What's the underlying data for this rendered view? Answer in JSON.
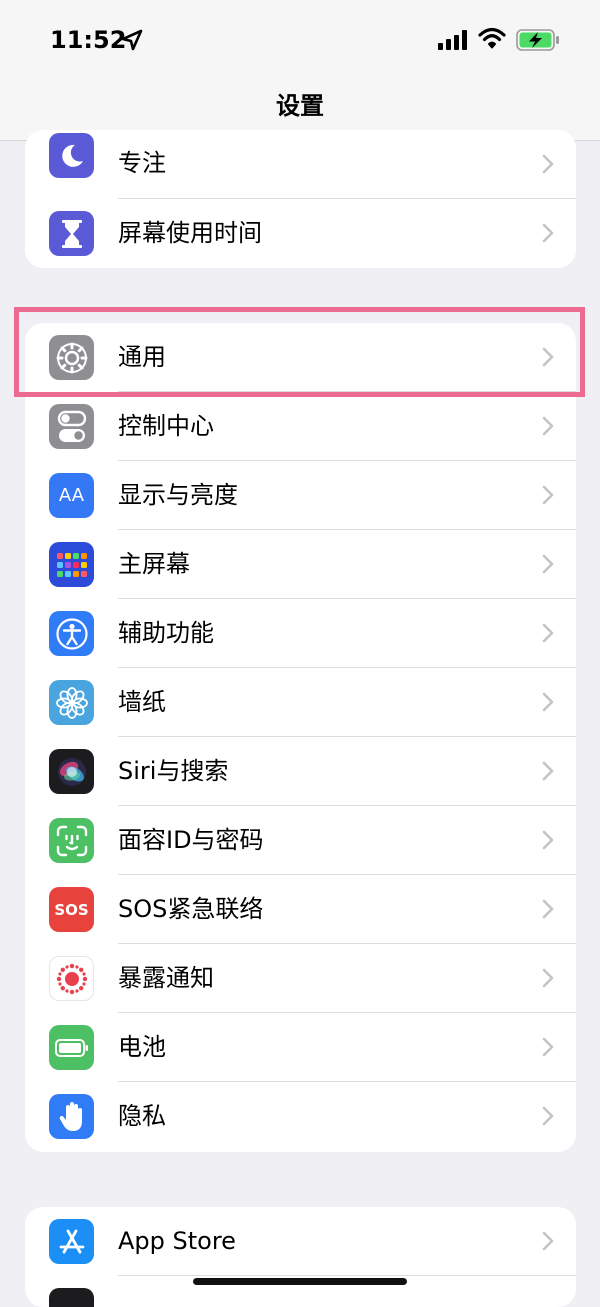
{
  "status_bar": {
    "time": "11:52"
  },
  "nav": {
    "title": "设置"
  },
  "groups": [
    {
      "items": [
        {
          "label": "专注",
          "icon": "moon-icon",
          "color": "#5b5ad6"
        },
        {
          "label": "屏幕使用时间",
          "icon": "hourglass-icon",
          "color": "#5b5ad6"
        }
      ]
    },
    {
      "items": [
        {
          "label": "通用",
          "icon": "gear-icon",
          "color": "#8e8e93"
        },
        {
          "label": "控制中心",
          "icon": "toggles-icon",
          "color": "#8e8e93"
        },
        {
          "label": "显示与亮度",
          "icon": "text-size-icon",
          "icon_text": "AA",
          "color": "#3478f6"
        },
        {
          "label": "主屏幕",
          "icon": "home-screen-grid-icon",
          "color": "#2b4bd8"
        },
        {
          "label": "辅助功能",
          "icon": "accessibility-icon",
          "color": "#2f7cf6"
        },
        {
          "label": "墙纸",
          "icon": "flower-icon",
          "color": "#4aa4de"
        },
        {
          "label": "Siri与搜索",
          "icon": "siri-icon",
          "color": "#1c1c1e"
        },
        {
          "label": "面容ID与密码",
          "icon": "face-id-icon",
          "color": "#4cc062"
        },
        {
          "label": "SOS紧急联络",
          "icon": "sos-icon",
          "icon_text": "SOS",
          "color": "#e7423c"
        },
        {
          "label": "暴露通知",
          "icon": "exposure-dots-icon",
          "color": "#ffffff"
        },
        {
          "label": "电池",
          "icon": "battery-icon",
          "color": "#4cc062"
        },
        {
          "label": "隐私",
          "icon": "hand-icon",
          "color": "#2f7cf6"
        }
      ]
    },
    {
      "items": [
        {
          "label": "App Store",
          "icon": "app-store-icon",
          "color": "#1b8ff5"
        }
      ]
    }
  ],
  "highlight": {
    "target": "通用",
    "color": "#ec6b90"
  }
}
